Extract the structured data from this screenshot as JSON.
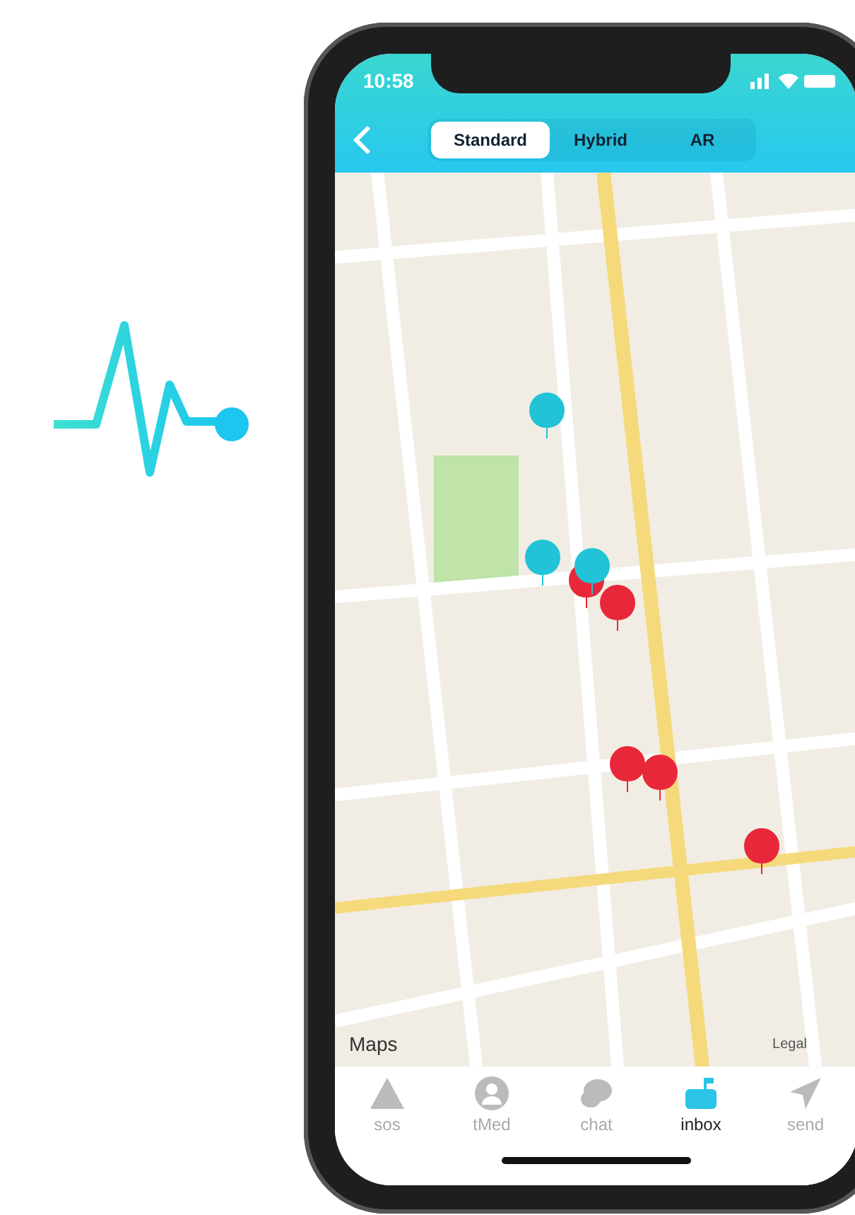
{
  "status_bar": {
    "time": "10:58"
  },
  "map_modes": [
    {
      "label": "Standard",
      "selected": true
    },
    {
      "label": "Hybrid",
      "selected": false
    },
    {
      "label": "AR",
      "selected": false
    }
  ],
  "map": {
    "attribution": "Maps",
    "legal": "Legal"
  },
  "tab_bar": [
    {
      "kind": "sos",
      "label": "sos",
      "selected": false
    },
    {
      "kind": "tmed",
      "label": "tMed",
      "selected": false
    },
    {
      "kind": "chat",
      "label": "chat",
      "selected": false
    },
    {
      "kind": "inbox",
      "label": "inbox",
      "selected": true
    },
    {
      "kind": "send",
      "label": "send",
      "selected": false
    }
  ]
}
